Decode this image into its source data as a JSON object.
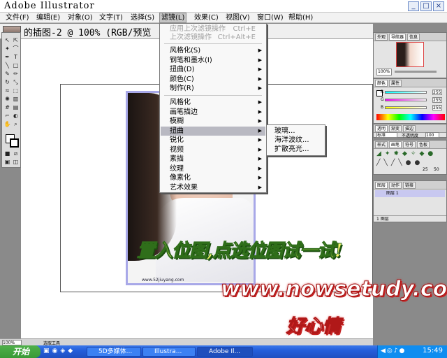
{
  "app": {
    "title": "Adobe Illustrator"
  },
  "window_buttons": {
    "minimize": "_",
    "maximize": "□",
    "close": "×"
  },
  "menubar": [
    "文件(F)",
    "编辑(E)",
    "对象(O)",
    "文字(T)",
    "选择(S)",
    "滤镜(L)",
    "效果(C)",
    "视图(V)",
    "窗口(W)",
    "帮助(H)"
  ],
  "document": {
    "title": "的插图-2 @ 100% (RGB/预览"
  },
  "filter_menu": {
    "apply_last": {
      "label": "应用上次滤镜操作",
      "shortcut": "Ctrl+E"
    },
    "last_filter": {
      "label": "上次滤镜操作",
      "shortcut": "Ctrl+Alt+E"
    },
    "vector_items": [
      "风格化(S)",
      "钢笔和墨水(I)",
      "扭曲(D)",
      "颜色(C)",
      "制作(R)"
    ],
    "bitmap_items": [
      "风格化",
      "画笔描边",
      "模糊",
      "扭曲",
      "锐化",
      "视频",
      "素描",
      "纹理",
      "像素化",
      "艺术效果"
    ],
    "highlighted": "扭曲"
  },
  "distort_submenu": [
    "玻璃...",
    "海洋波纹...",
    "扩散亮光..."
  ],
  "panels": {
    "navigator": {
      "tabs": [
        "外观",
        "导航器",
        "信息"
      ],
      "zoom": "100%"
    },
    "color": {
      "tabs": [
        "颜色",
        "属性"
      ],
      "channels": [
        {
          "label": "R",
          "value": "255"
        },
        {
          "label": "G",
          "value": "255"
        },
        {
          "label": "B",
          "value": "255"
        }
      ]
    },
    "transparency": {
      "tabs": [
        "透明",
        "渐变",
        "描边"
      ],
      "mode": "标准",
      "opacity_label": "不透明度",
      "opacity": "100"
    },
    "brushes": {
      "tabs": [
        "样式",
        "画笔",
        "符号",
        "色板"
      ],
      "sizes": [
        "25",
        "50"
      ]
    },
    "layers": {
      "tabs": [
        "图层",
        "动作",
        "链接"
      ],
      "layer_name": "图层 1",
      "footer": "1 图层"
    }
  },
  "status": {
    "zoom": "100%",
    "tool": "选取工具"
  },
  "artwork": {
    "small_text": "www.52jiuyang.com"
  },
  "taskbar": {
    "start": "开始",
    "tasks": [
      "5D多媒体...",
      "Illustra...",
      "Adobe Il..."
    ],
    "clock": "15:49"
  },
  "overlay": {
    "line1": "置入位图,点选位图试一试!",
    "line2": "www.nowsetudy.com",
    "line3": "好心情"
  }
}
